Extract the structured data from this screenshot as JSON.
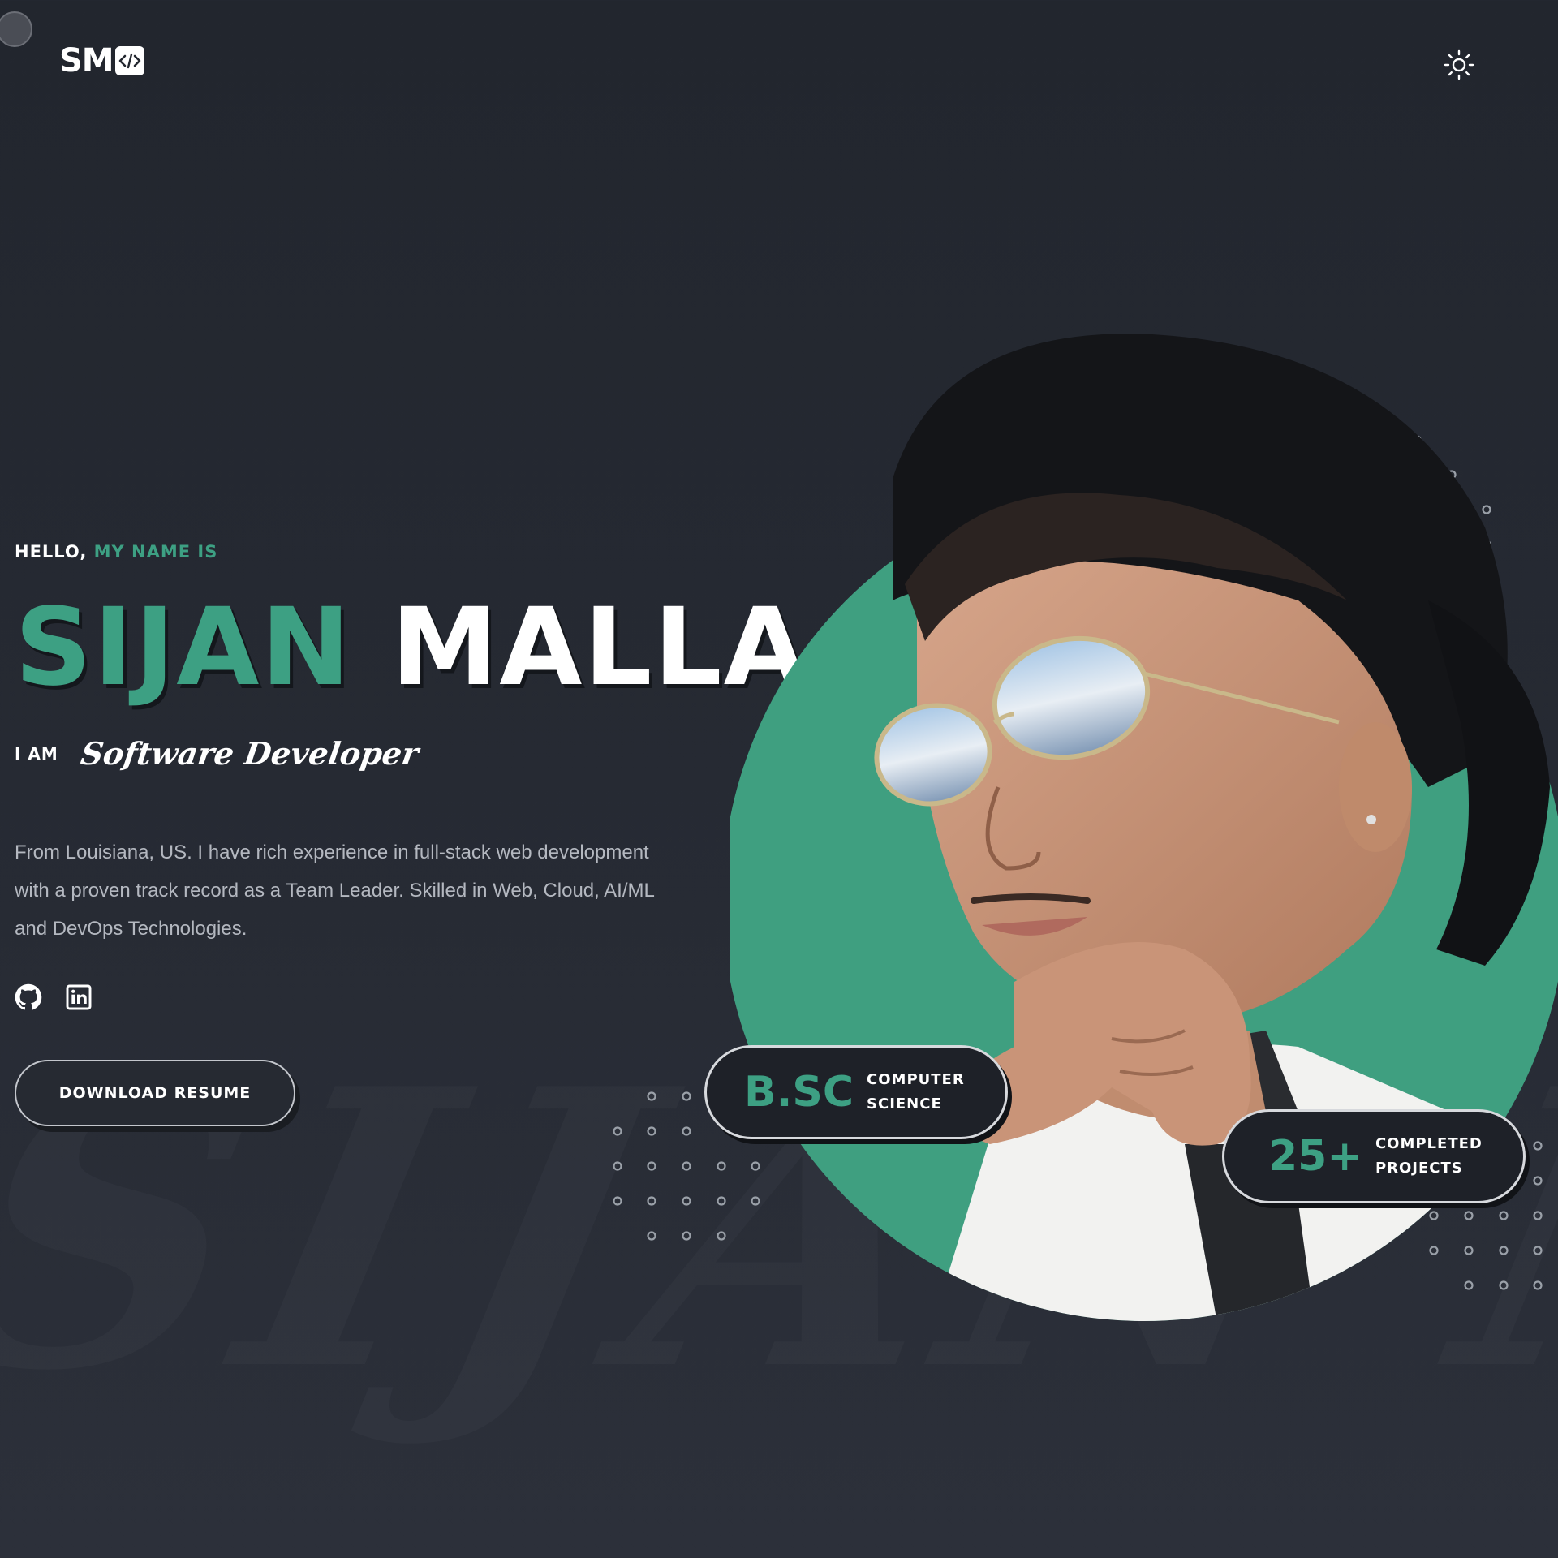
{
  "header": {
    "logo_text": "SM",
    "logo_badge_icon": "code-icon",
    "theme_toggle_icon": "sun-icon"
  },
  "hero": {
    "greeting_hello": "HELLO,",
    "greeting_name_is": "MY NAME IS",
    "first_name": "SIJAN",
    "last_name": "MALLA",
    "iam_label": "I AM",
    "role": "Software Developer",
    "bio": "From Louisiana, US. I have rich experience in full-stack web development with a proven track record as a Team Leader. Skilled in Web, Cloud, AI/ML and DevOps Technologies.",
    "socials": [
      {
        "icon": "github-icon"
      },
      {
        "icon": "linkedin-icon"
      }
    ],
    "resume_button": "DOWNLOAD RESUME",
    "watermark": "SIJAN MALLA"
  },
  "badges": {
    "degree_big": "B.SC",
    "degree_line1": "COMPUTER",
    "degree_line2": "SCIENCE",
    "projects_big": "25+",
    "projects_line1": "COMPLETED",
    "projects_line2": "PROJECTS"
  },
  "colors": {
    "accent": "#3da083",
    "background": "#262a33",
    "text": "#ffffff",
    "muted_text": "#b4b8c0"
  }
}
